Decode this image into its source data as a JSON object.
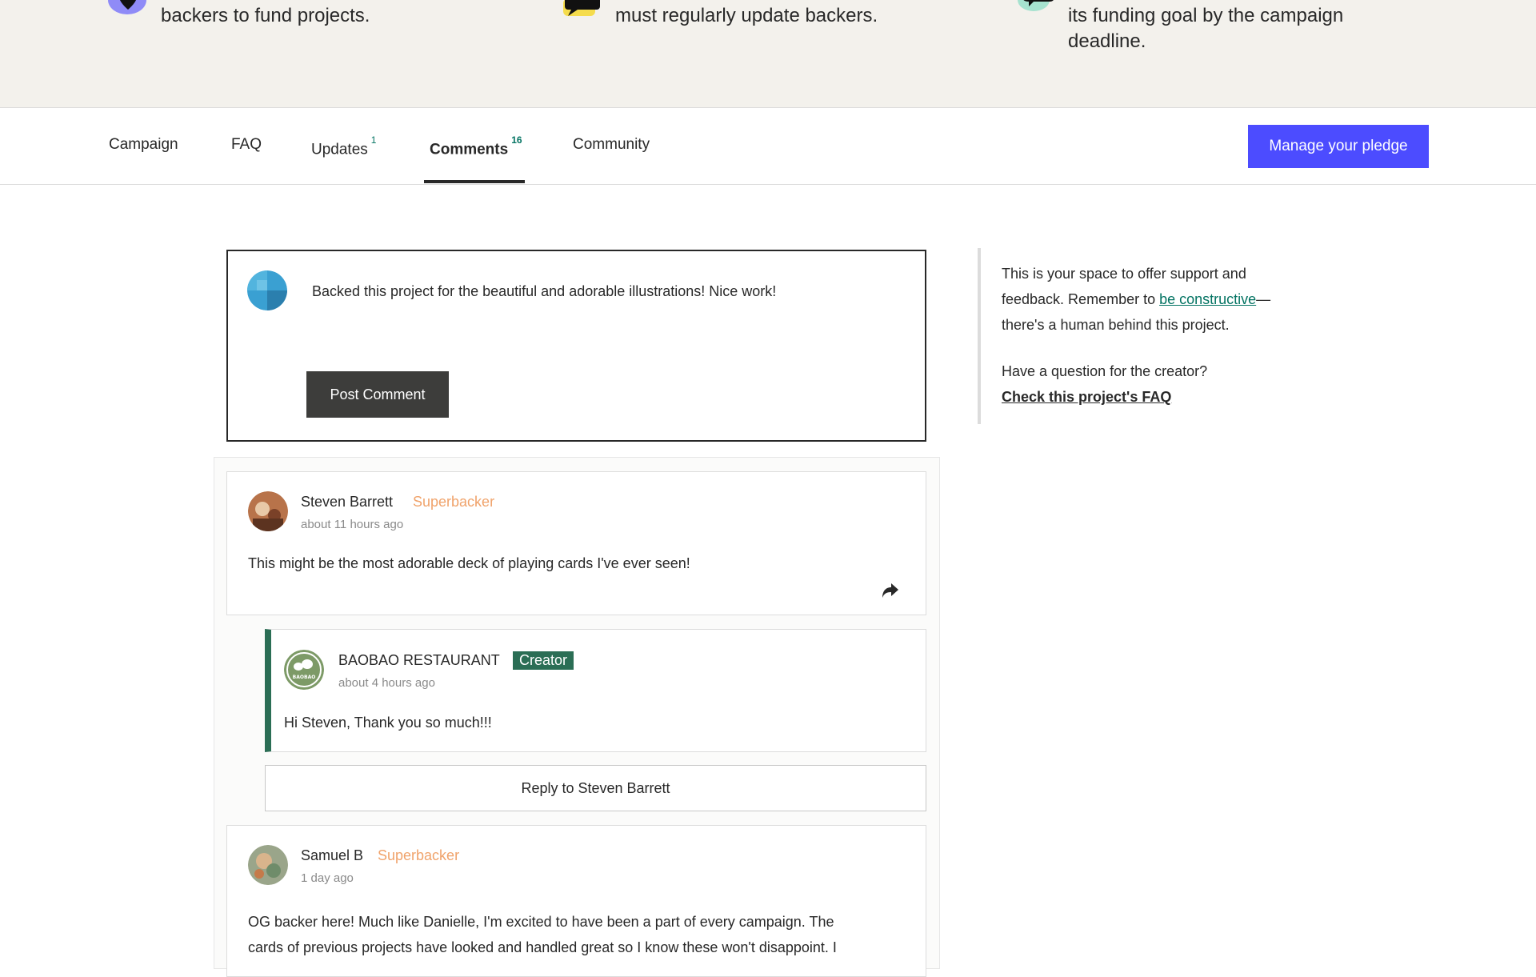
{
  "info_band": {
    "items": [
      {
        "icon": "location-pin-icon",
        "text": "backers to fund projects."
      },
      {
        "icon": "chat-bubbles-icon",
        "text": "must regularly update backers."
      },
      {
        "icon": "money-bubble-icon",
        "text_line1": "its funding goal by the campaign",
        "text_line2": "deadline."
      }
    ]
  },
  "tabs": [
    {
      "label": "Campaign",
      "count": ""
    },
    {
      "label": "FAQ",
      "count": ""
    },
    {
      "label": "Updates",
      "count": "1"
    },
    {
      "label": "Comments",
      "count": "16",
      "active": true
    },
    {
      "label": "Community",
      "count": ""
    }
  ],
  "manage_pledge_label": "Manage your pledge",
  "composer": {
    "text": "Backed this project for the beautiful and adorable illustrations! Nice work!",
    "post_label": "Post Comment"
  },
  "comments": [
    {
      "author": "Steven Barrett",
      "badge": "Superbacker",
      "time": "about 11 hours ago",
      "body": "This might be the most adorable deck of playing cards I've ever seen!",
      "share_icon": "share-arrow-icon",
      "reply": {
        "author": "BAOBAO RESTAURANT",
        "badge": "Creator",
        "time": "about 4 hours ago",
        "body": "Hi Steven, Thank you so much!!!",
        "avatar_text": "BAOBAO"
      },
      "reply_button_label": "Reply to Steven Barrett"
    },
    {
      "author": "Samuel B",
      "badge": "Superbacker",
      "time": "1 day ago",
      "body_line1": "OG backer here! Much like Danielle, I'm excited to have been a part of every campaign. The",
      "body_line2": "cards of previous projects have looked and handled great so I know these won't disappoint. I"
    }
  ],
  "sidebar": {
    "line1": "This is your space to offer support and",
    "line2_pre": "feedback. Remember to ",
    "line2_link": "be constructive",
    "line2_post": "—",
    "line3": "there's a human behind this project.",
    "question": "Have a question for the creator?",
    "faq_link": "Check this project's FAQ"
  },
  "colors": {
    "accent": "#4c4cff",
    "creator_green": "#2b6e55",
    "superbacker_orange": "#f0a36b",
    "link_green": "#037362"
  }
}
